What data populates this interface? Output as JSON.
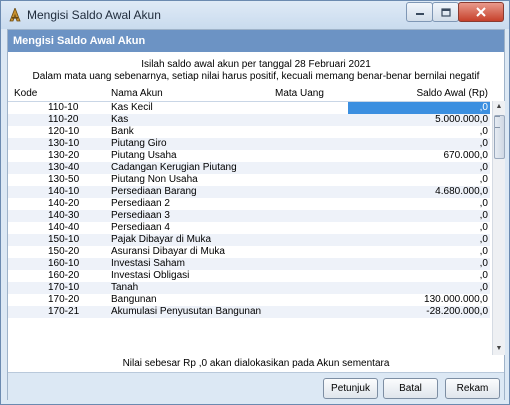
{
  "window": {
    "title": "Mengisi Saldo Awal Akun"
  },
  "header": {
    "title": "Mengisi Saldo Awal Akun"
  },
  "info": {
    "line1": "Isilah saldo awal akun per tanggal 28 Februari 2021",
    "line2": "Dalam mata uang sebenarnya, setiap nilai harus positif, kecuali memang benar-benar bernilai negatif"
  },
  "columns": {
    "kode": "Kode",
    "nama": "Nama Akun",
    "mata_uang": "Mata Uang",
    "saldo": "Saldo Awal (Rp)"
  },
  "rows": [
    {
      "kode": "110-10",
      "nama": "Kas Kecil",
      "saldo": ",0"
    },
    {
      "kode": "110-20",
      "nama": "Kas",
      "saldo": "5.000.000,0"
    },
    {
      "kode": "120-10",
      "nama": "Bank",
      "saldo": ",0"
    },
    {
      "kode": "130-10",
      "nama": "Piutang Giro",
      "saldo": ",0"
    },
    {
      "kode": "130-20",
      "nama": "Piutang Usaha",
      "saldo": "670.000,0"
    },
    {
      "kode": "130-40",
      "nama": "Cadangan Kerugian Piutang",
      "saldo": ",0"
    },
    {
      "kode": "130-50",
      "nama": "Piutang Non Usaha",
      "saldo": ",0"
    },
    {
      "kode": "140-10",
      "nama": "Persediaan Barang",
      "saldo": "4.680.000,0"
    },
    {
      "kode": "140-20",
      "nama": "Persediaan 2",
      "saldo": ",0"
    },
    {
      "kode": "140-30",
      "nama": "Persediaan 3",
      "saldo": ",0"
    },
    {
      "kode": "140-40",
      "nama": "Persediaan 4",
      "saldo": ",0"
    },
    {
      "kode": "150-10",
      "nama": "Pajak Dibayar di Muka",
      "saldo": ",0"
    },
    {
      "kode": "150-20",
      "nama": "Asuransi Dibayar di Muka",
      "saldo": ",0"
    },
    {
      "kode": "160-10",
      "nama": "Investasi Saham",
      "saldo": ",0"
    },
    {
      "kode": "160-20",
      "nama": "Investasi Obligasi",
      "saldo": ",0"
    },
    {
      "kode": "170-10",
      "nama": "Tanah",
      "saldo": ",0"
    },
    {
      "kode": "170-20",
      "nama": "Bangunan",
      "saldo": "130.000.000,0"
    },
    {
      "kode": "170-21",
      "nama": "Akumulasi Penyusutan Bangunan",
      "saldo": "-28.200.000,0"
    }
  ],
  "note": "Nilai sebesar Rp ,0 akan dialokasikan pada Akun sementara",
  "buttons": {
    "petunjuk": "Petunjuk",
    "batal": "Batal",
    "rekam": "Rekam"
  },
  "icons": {
    "app": "app-icon",
    "minimize": "minimize-icon",
    "maximize": "maximize-icon",
    "close": "close-icon"
  },
  "colors": {
    "header": "#6c93c4",
    "selection": "#3b8fe0",
    "panel": "#dce8f4"
  }
}
